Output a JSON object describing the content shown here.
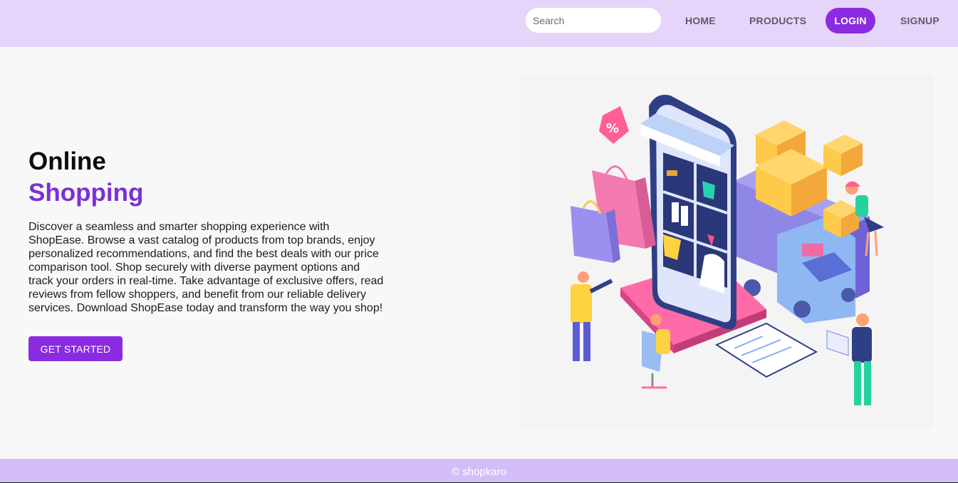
{
  "nav": {
    "search_placeholder": "Search",
    "links": [
      "HOME",
      "PRODUCTS",
      "LOGIN",
      "SIGNUP"
    ],
    "accent": "#8a2be2",
    "bar_color": "#e5d5fb"
  },
  "hero": {
    "title_line1": "Online",
    "title_line2": "Shopping",
    "description": "Discover a seamless and smarter shopping experience with ShopEase. Browse a vast catalog of products from top brands, enjoy personalized recommendations, and find the best deals with our price comparison tool. Shop securely with diverse payment options and track your orders in real-time. Take advantage of exclusive offers, read reviews from fellow shoppers, and benefit from our reliable delivery services. Download ShopEase today and transform the way you shop!",
    "cta_label": "GET STARTED",
    "title_accent": "#7b2fd8"
  },
  "illustration": {
    "icon": "online-shopping-illustration",
    "percent_tag": "%"
  },
  "footer": {
    "text": "© shopkaro",
    "color": "#d3bef8"
  }
}
